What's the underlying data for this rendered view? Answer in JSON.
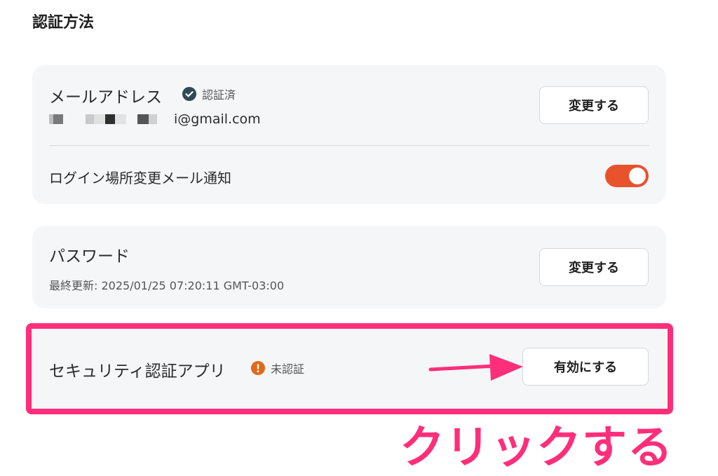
{
  "section": {
    "title": "認証方法"
  },
  "email": {
    "title": "メールアドレス",
    "status": "認証済",
    "address_suffix": "i@gmail.com",
    "button": "変更する"
  },
  "login_notify": {
    "label": "ログイン場所変更メール通知",
    "enabled": true
  },
  "password": {
    "title": "パスワード",
    "last_updated": "最終更新: 2025/01/25 07:20:11 GMT-03:00",
    "button": "変更する"
  },
  "auth_app": {
    "title": "セキュリティ認証アプリ",
    "status": "未認証",
    "button": "有効にする"
  },
  "annotation": {
    "text": "クリックする"
  },
  "colors": {
    "highlight": "#ff2e7a",
    "toggle_on": "#e8522d",
    "verified": "#2f4a54",
    "warning": "#e06a1b",
    "card_bg": "#f5f6f8"
  },
  "icons": {
    "verified": "check-circle-icon",
    "warning": "exclamation-circle-icon",
    "arrow": "arrow-right-icon"
  }
}
